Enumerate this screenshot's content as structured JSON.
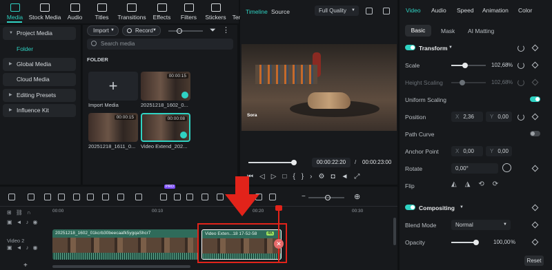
{
  "top_nav": {
    "items": [
      {
        "label": "Media",
        "icon": "media-icon",
        "active": true
      },
      {
        "label": "Stock Media",
        "icon": "stock-media-icon"
      },
      {
        "label": "Audio",
        "icon": "audio-icon"
      },
      {
        "label": "Titles",
        "icon": "titles-icon"
      },
      {
        "label": "Transitions",
        "icon": "transitions-icon"
      },
      {
        "label": "Effects",
        "icon": "effects-icon"
      },
      {
        "label": "Filters",
        "icon": "filters-icon"
      },
      {
        "label": "Stickers",
        "icon": "stickers-icon"
      },
      {
        "label": "Templates",
        "icon": "templates-icon"
      }
    ]
  },
  "sidebar": {
    "items": [
      {
        "label": "Project Media"
      },
      {
        "label": "Folder"
      },
      {
        "label": "Global Media"
      },
      {
        "label": "Cloud Media"
      },
      {
        "label": "Editing Presets"
      },
      {
        "label": "Influence Kit"
      }
    ]
  },
  "media": {
    "import_label": "Import",
    "record_label": "Record",
    "search_placeholder": "Search media",
    "folder_heading": "FOLDER",
    "import_tile_label": "Import Media",
    "items": [
      {
        "name": "20251218_1602_0...",
        "duration": "00:00:15"
      },
      {
        "name": "20251218_1611_0...",
        "duration": "00:00:15"
      },
      {
        "name": "Video Extend_202...",
        "duration": "00:00:08"
      }
    ]
  },
  "preview": {
    "tab_timeline": "Timeline",
    "tab_source": "Source",
    "quality": "Full Quality",
    "watermark": "Sora",
    "current_time": "00:00:22:20",
    "separator": "/",
    "total_time": "00:00:23:00",
    "progress": 0.97
  },
  "inspector": {
    "tabs": [
      "Video",
      "Audio",
      "Speed",
      "Animation",
      "Color"
    ],
    "subtabs": [
      "Basic",
      "Mask",
      "AI Matting"
    ],
    "transform_heading": "Transform",
    "scale_label": "Scale",
    "scale_value": "102,68",
    "height_scaling_label": "Height Scaling",
    "height_scaling_value": "102,68",
    "percent": "%",
    "uniform_scaling_label": "Uniform Scaling",
    "position_label": "Position",
    "position_x": "2,36",
    "position_y": "0,00",
    "x_letter": "X",
    "y_letter": "Y",
    "path_curve_label": "Path Curve",
    "anchor_point_label": "Anchor Point",
    "anchor_x": "0,00",
    "anchor_y": "0,00",
    "rotate_label": "Rotate",
    "rotate_value": "0,00°",
    "flip_label": "Flip",
    "compositing_heading": "Compositing",
    "blend_mode_label": "Blend Mode",
    "blend_mode_value": "Normal",
    "opacity_label": "Opacity",
    "opacity_value": "100,00",
    "reset_label": "Reset",
    "scale_level": 0.4,
    "opacity_level": 1.0
  },
  "timeline": {
    "ruler": [
      "00:00",
      "00:10",
      "00:20",
      "00:30"
    ],
    "track_label": "Video 2",
    "pro_badge": "PRO",
    "clip1_title": "20251218_1602_01kcrb30beecaafk5ygqaShcr7",
    "clip2_title": "Video Exten...18 17-52-58",
    "clip2_badge": "4K"
  },
  "colors": {
    "accent": "#2fd3c3",
    "annotation": "#e2231a",
    "track": "#2f6b5a"
  }
}
